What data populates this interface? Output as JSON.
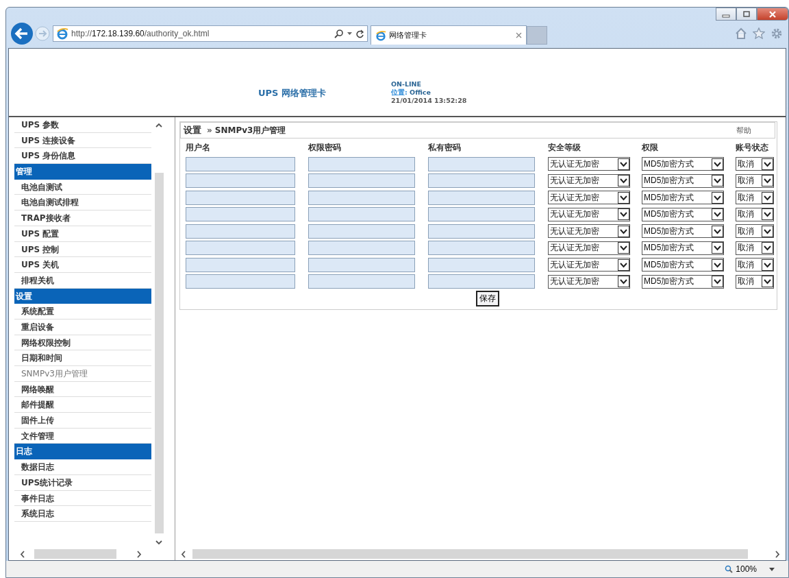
{
  "browser": {
    "url_prefix": "http://",
    "url_host": "172.18.139.60",
    "url_path": "/authority_ok.html",
    "tab_title": "网络管理卡"
  },
  "header": {
    "title": "UPS 网络管理卡",
    "status": "ON-LINE",
    "location_label": "位置:",
    "location": "Office",
    "datetime": "21/01/2014 13:52:28"
  },
  "sidebar": {
    "items": [
      {
        "kind": "item",
        "label": "UPS 参数",
        "selected": false
      },
      {
        "kind": "item",
        "label": "UPS 连接设备",
        "selected": false
      },
      {
        "kind": "item",
        "label": "UPS 身份信息",
        "selected": false
      },
      {
        "kind": "header",
        "label": "管理"
      },
      {
        "kind": "item",
        "label": "电池自测试",
        "selected": false
      },
      {
        "kind": "item",
        "label": "电池自测试排程",
        "selected": false
      },
      {
        "kind": "item",
        "label": "TRAP接收者",
        "selected": false
      },
      {
        "kind": "item",
        "label": "UPS 配置",
        "selected": false
      },
      {
        "kind": "item",
        "label": "UPS 控制",
        "selected": false
      },
      {
        "kind": "item",
        "label": "UPS 关机",
        "selected": false
      },
      {
        "kind": "item",
        "label": "排程关机",
        "selected": false
      },
      {
        "kind": "header",
        "label": "设置"
      },
      {
        "kind": "item",
        "label": "系统配置",
        "selected": false
      },
      {
        "kind": "item",
        "label": "重启设备",
        "selected": false
      },
      {
        "kind": "item",
        "label": "网络权限控制",
        "selected": false
      },
      {
        "kind": "item",
        "label": "日期和时间",
        "selected": false
      },
      {
        "kind": "item",
        "label": "SNMPv3用户管理",
        "selected": true
      },
      {
        "kind": "item",
        "label": "网络唤醒",
        "selected": false
      },
      {
        "kind": "item",
        "label": "邮件提醒",
        "selected": false
      },
      {
        "kind": "item",
        "label": "固件上传",
        "selected": false
      },
      {
        "kind": "item",
        "label": "文件管理",
        "selected": false
      },
      {
        "kind": "header",
        "label": "日志"
      },
      {
        "kind": "item",
        "label": "数据日志",
        "selected": false
      },
      {
        "kind": "item",
        "label": "UPS统计记录",
        "selected": false
      },
      {
        "kind": "item",
        "label": "事件日志",
        "selected": false
      },
      {
        "kind": "item",
        "label": "系统日志",
        "selected": false
      }
    ]
  },
  "main": {
    "breadcrumb": {
      "section": "设置",
      "separator": "»",
      "page": "SNMPv3用户管理"
    },
    "help": "帮助",
    "table": {
      "columns": [
        "用户名",
        "权限密码",
        "私有密码",
        "安全等级",
        "权限",
        "账号状态"
      ],
      "rows": [
        {
          "security": "无认证无加密",
          "permission": "MD5加密方式",
          "state": "取消"
        },
        {
          "security": "无认证无加密",
          "permission": "MD5加密方式",
          "state": "取消"
        },
        {
          "security": "无认证无加密",
          "permission": "MD5加密方式",
          "state": "取消"
        },
        {
          "security": "无认证无加密",
          "permission": "MD5加密方式",
          "state": "取消"
        },
        {
          "security": "无认证无加密",
          "permission": "MD5加密方式",
          "state": "取消"
        },
        {
          "security": "无认证无加密",
          "permission": "MD5加密方式",
          "state": "取消"
        },
        {
          "security": "无认证无加密",
          "permission": "MD5加密方式",
          "state": "取消"
        },
        {
          "security": "无认证无加密",
          "permission": "MD5加密方式",
          "state": "取消"
        }
      ]
    },
    "save_button": "保存"
  },
  "status_bar": {
    "zoom": "100%"
  }
}
